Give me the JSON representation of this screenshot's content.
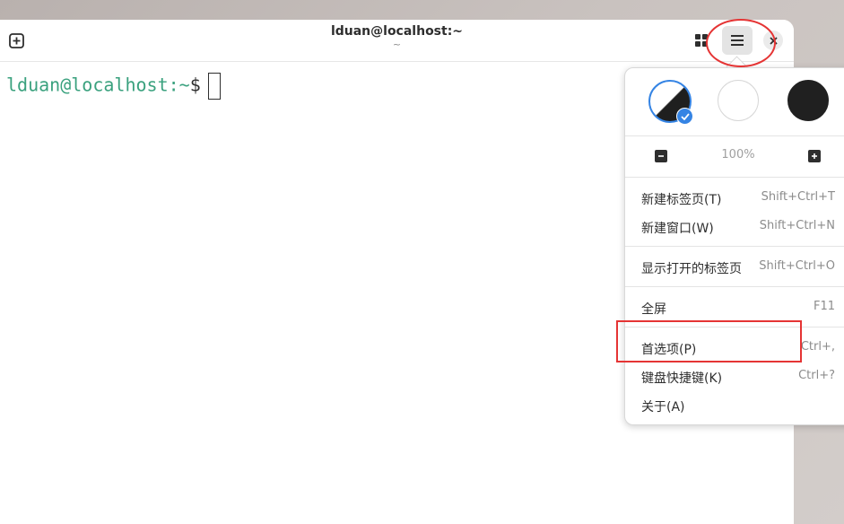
{
  "window": {
    "title": "lduan@localhost:~",
    "subtitle": "~"
  },
  "terminal": {
    "user_host": "lduan@localhost",
    "separator": ":",
    "path": "~",
    "symbol": "$"
  },
  "menu": {
    "zoom_level": "100%",
    "items": [
      {
        "label": "新建标签页(T)",
        "accel": "Shift+Ctrl+T"
      },
      {
        "label": "新建窗口(W)",
        "accel": "Shift+Ctrl+N"
      },
      {
        "label": "显示打开的标签页",
        "accel": "Shift+Ctrl+O"
      },
      {
        "label": "全屏",
        "accel": "F11"
      },
      {
        "label": "首选项(P)",
        "accel": "Ctrl+,"
      },
      {
        "label": "键盘快捷键(K)",
        "accel": "Ctrl+?"
      },
      {
        "label": "关于(A)",
        "accel": ""
      }
    ]
  },
  "icons": {
    "new_tab": "new-tab-icon",
    "overview": "tab-overview-icon",
    "menu": "hamburger-menu-icon",
    "close": "close-icon",
    "zoom_out": "zoom-out-icon",
    "zoom_in": "zoom-in-icon",
    "check": "checkmark-icon"
  },
  "colors": {
    "accent": "#3584e4",
    "prompt": "#3aa17e",
    "annotation": "#e53434"
  }
}
